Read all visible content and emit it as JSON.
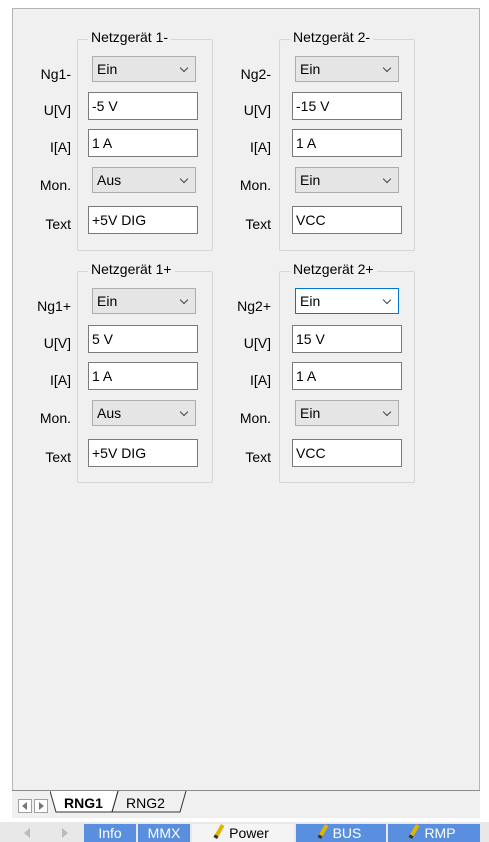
{
  "groups": [
    {
      "title": "Netzgerät 1-",
      "rows": {
        "state_label": "Ng1-",
        "state_value": "Ein",
        "u_label": "U[V]",
        "u_value": "-5 V",
        "i_label": "I[A]",
        "i_value": "1 A",
        "mon_label": "Mon.",
        "mon_value": "Aus",
        "text_label": "Text",
        "text_value": "+5V DIG"
      }
    },
    {
      "title": "Netzgerät 2-",
      "rows": {
        "state_label": "Ng2-",
        "state_value": "Ein",
        "u_label": "U[V]",
        "u_value": "-15 V",
        "i_label": "I[A]",
        "i_value": "1 A",
        "mon_label": "Mon.",
        "mon_value": "Ein",
        "text_label": "Text",
        "text_value": "VCC"
      }
    },
    {
      "title": "Netzgerät 1+",
      "rows": {
        "state_label": "Ng1+",
        "state_value": "Ein",
        "u_label": "U[V]",
        "u_value": "5 V",
        "i_label": "I[A]",
        "i_value": "1 A",
        "mon_label": "Mon.",
        "mon_value": "Aus",
        "text_label": "Text",
        "text_value": "+5V DIG"
      }
    },
    {
      "title": "Netzgerät 2+",
      "rows": {
        "state_label": "Ng2+",
        "state_value": "Ein",
        "u_label": "U[V]",
        "u_value": "15 V",
        "i_label": "I[A]",
        "i_value": "1 A",
        "mon_label": "Mon.",
        "mon_value": "Ein",
        "text_label": "Text",
        "text_value": "VCC"
      }
    }
  ],
  "sheet_tabs": [
    "RNG1",
    "RNG2"
  ],
  "active_sheet_tab": "RNG1",
  "bottom_tabs": [
    "Info",
    "MMX",
    "Power",
    "BUS",
    "RMP"
  ],
  "active_bottom_tab": "Power",
  "colors": {
    "focus_border": "#0078d7",
    "tab_blue": "#5a8fe0"
  },
  "icons": {
    "dropdown": "chevron-down-icon",
    "tab_decoration": "pencil-icon",
    "nav": [
      "arrow-left-icon",
      "arrow-right-icon"
    ]
  }
}
